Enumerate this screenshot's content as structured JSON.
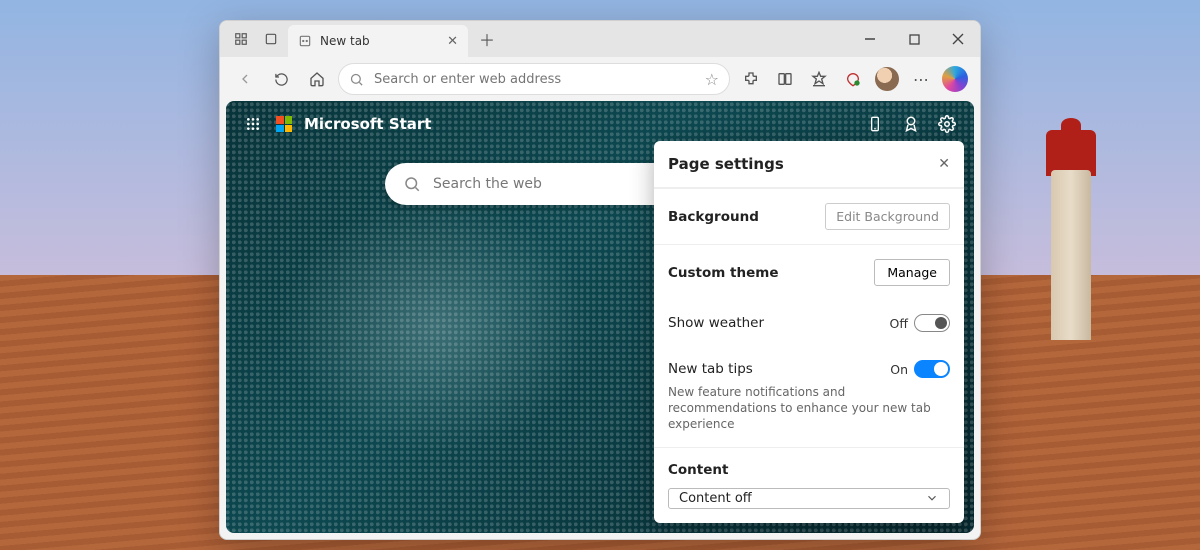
{
  "tab": {
    "title": "New tab"
  },
  "addressbar": {
    "placeholder": "Search or enter web address"
  },
  "ntp": {
    "brand": "Microsoft Start",
    "search_placeholder": "Search the web"
  },
  "panel": {
    "title": "Page settings",
    "background_label": "Background",
    "edit_background": "Edit Background",
    "custom_theme_label": "Custom theme",
    "manage": "Manage",
    "show_weather_label": "Show weather",
    "show_weather_state": "Off",
    "new_tab_tips_label": "New tab tips",
    "new_tab_tips_state": "On",
    "new_tab_tips_desc": "New feature notifications and recommendations to enhance your new tab experience",
    "content_heading": "Content",
    "content_select_value": "Content off"
  }
}
